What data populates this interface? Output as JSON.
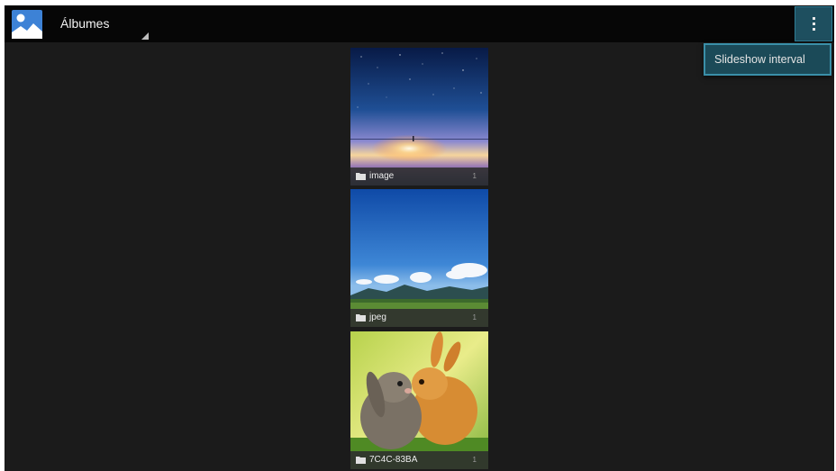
{
  "actionbar": {
    "app_icon": "gallery-icon",
    "title": "Álbumes",
    "overflow_icon": "more-vert-icon"
  },
  "overflow_menu": {
    "items": [
      {
        "label": "Slideshow interval"
      }
    ]
  },
  "albums": [
    {
      "name": "image",
      "count": "1",
      "thumbnail": "night-sky-lake-photo",
      "icon": "folder-icon"
    },
    {
      "name": "jpeg",
      "count": "1",
      "thumbnail": "blue-sky-meadow-photo",
      "icon": "folder-icon"
    },
    {
      "name": "7C4C-83BA",
      "count": "1",
      "thumbnail": "two-rabbits-photo",
      "icon": "folder-icon"
    }
  ],
  "colors": {
    "background": "#1b1b1b",
    "actionbar": "#060606",
    "menu_accent": "#1b4a58",
    "menu_border": "#3a8fa8"
  }
}
